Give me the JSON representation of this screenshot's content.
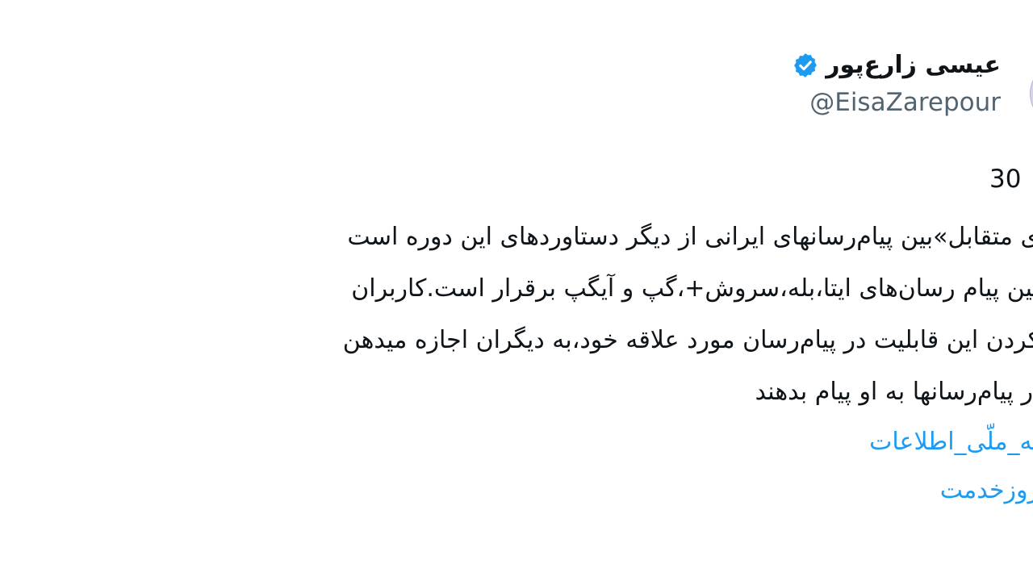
{
  "author": {
    "name": "عیسی زارع‌پور",
    "handle": "@EisaZarepour",
    "verified": true,
    "verified_color": "#1d9bf0"
  },
  "tweet": {
    "timestamp": "30",
    "lines": [
      "ی متقابل»بین پیام‌رسانهای ایرانی از دیگر دستاوردهای این دوره است",
      "بین پیام رسان‌های ایتا،بله،سروش+،گپ و آیگپ برقرار است.کاربران",
      "کردن این قابلیت در پیام‌رسان مورد علاقه خود،به دیگران اجازه میدهن",
      "ر پیام‌رسانها به او پیام بدهند"
    ],
    "hashtags": [
      "به_ملّی_اطلاعات",
      "روزخدمت"
    ],
    "hashtag_color": "#1d9bf0"
  }
}
